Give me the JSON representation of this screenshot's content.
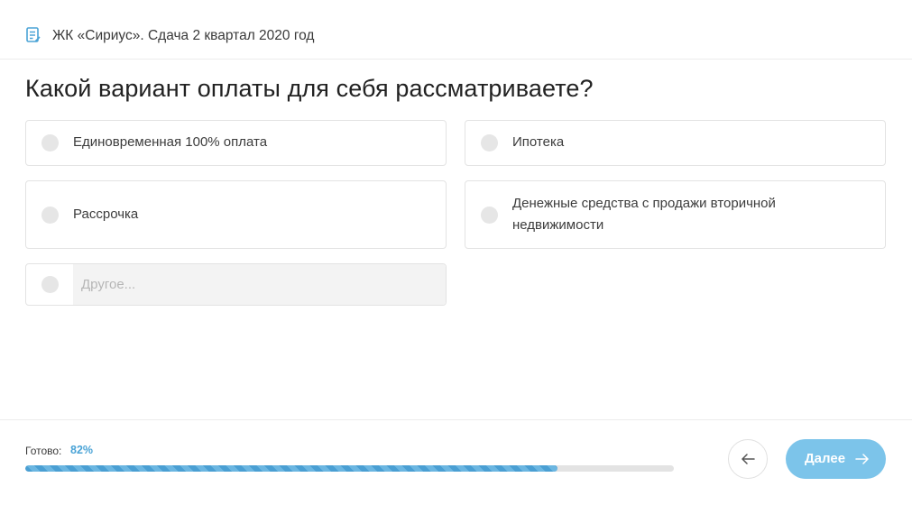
{
  "header": {
    "icon": "form-icon",
    "title": "ЖК «Сириус». Сдача 2 квартал 2020 год"
  },
  "question": "Какой вариант оплаты для себя рассматриваете?",
  "options": [
    {
      "label": "Единовременная 100% оплата",
      "selected": false
    },
    {
      "label": "Ипотека",
      "selected": false
    },
    {
      "label": "Рассрочка",
      "selected": false
    },
    {
      "label": "Денежные средства с продажи вторичной недвижимости",
      "selected": false
    }
  ],
  "other_option": {
    "placeholder": "Другое...",
    "value": ""
  },
  "footer": {
    "progress_label": "Готово:",
    "progress_text": "82%",
    "progress_fraction": 0.82,
    "back_icon": "arrow-left-icon",
    "next_label": "Далее",
    "next_icon": "arrow-right-icon"
  },
  "colors": {
    "accent": "#4aa3d6",
    "next_button": "#7cc4ea",
    "radio": "#e6e6e6"
  }
}
